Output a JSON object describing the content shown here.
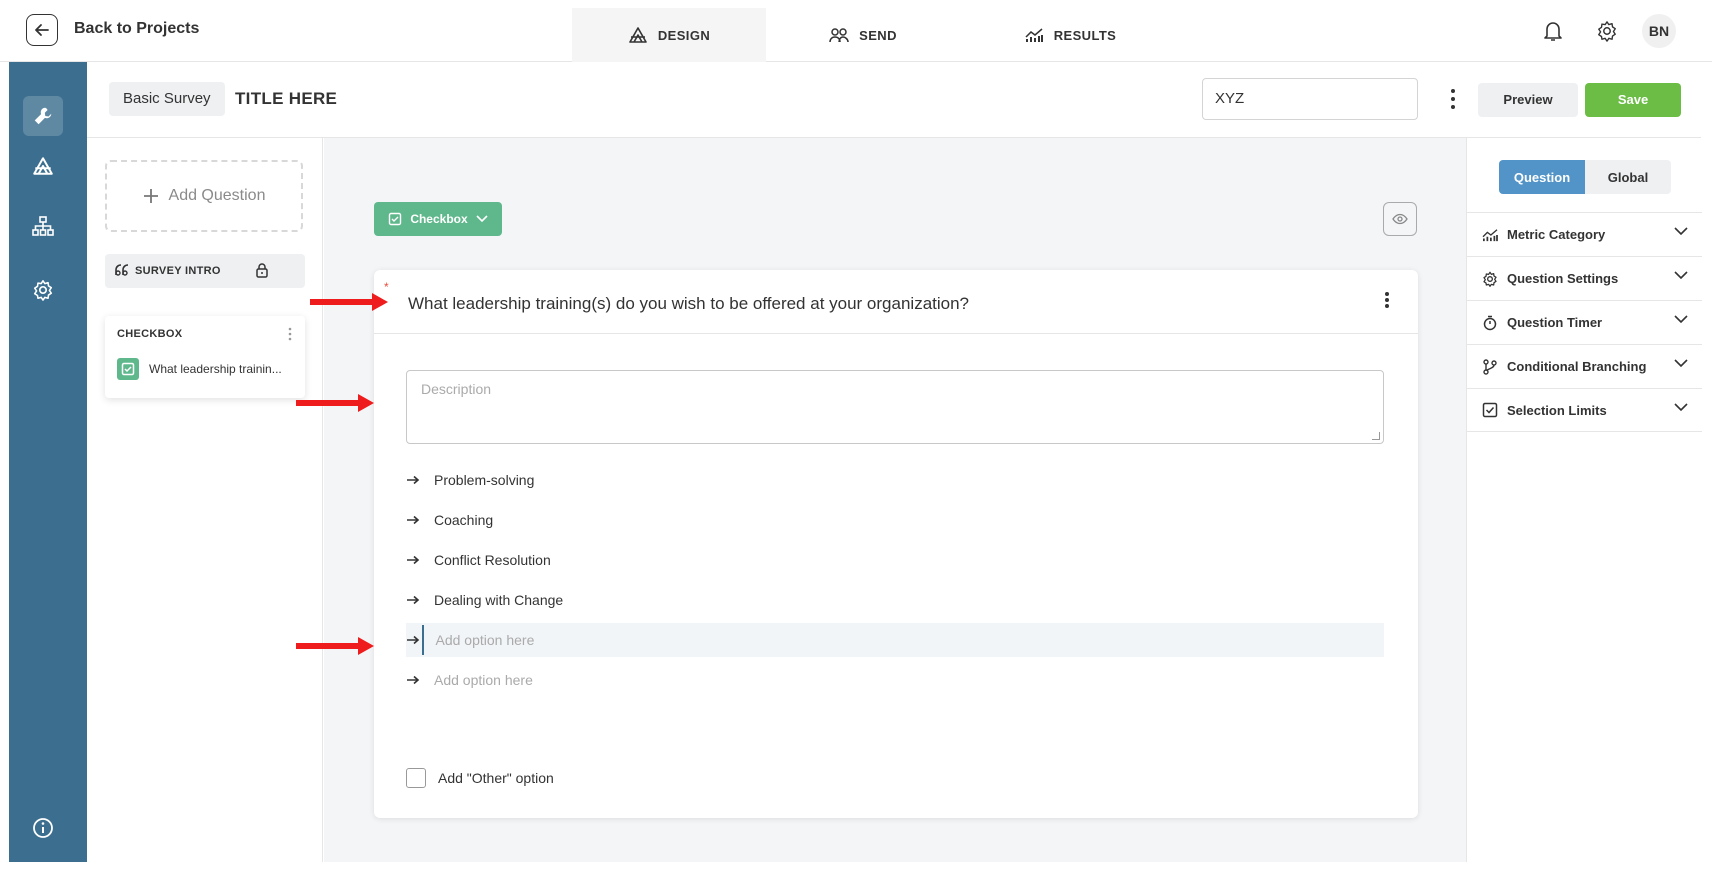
{
  "topbar": {
    "back_label": "Back to Projects",
    "tabs": [
      {
        "label": "DESIGN",
        "icon": "design-icon",
        "active": true
      },
      {
        "label": "SEND",
        "icon": "people-icon",
        "active": false
      },
      {
        "label": "RESULTS",
        "icon": "chart-icon",
        "active": false
      }
    ],
    "avatar_initials": "BN"
  },
  "header": {
    "survey_type": "Basic Survey",
    "survey_title": "TITLE HERE",
    "name_field_value": "XYZ",
    "preview_label": "Preview",
    "save_label": "Save"
  },
  "question_list": {
    "add_label": "Add Question",
    "intro_label": "SURVEY INTRO",
    "card_type": "CHECKBOX",
    "card_text": "What leadership trainin..."
  },
  "editor": {
    "type_label": "Checkbox",
    "question_text": "What leadership training(s) do you wish to be offered at your organization?",
    "description_placeholder": "Description",
    "options": [
      {
        "label": "Problem-solving",
        "placeholder": false
      },
      {
        "label": "Coaching",
        "placeholder": false
      },
      {
        "label": "Conflict Resolution",
        "placeholder": false
      },
      {
        "label": "Dealing with Change",
        "placeholder": false
      },
      {
        "label": "Add option here",
        "placeholder": true,
        "focused": true
      },
      {
        "label": "Add option here",
        "placeholder": true
      }
    ],
    "other_option_label": "Add \"Other\" option"
  },
  "settings_panel": {
    "tabs": [
      "Question",
      "Global"
    ],
    "active_tab": "Question",
    "sections": [
      {
        "label": "Metric Category",
        "icon": "chart-icon"
      },
      {
        "label": "Question Settings",
        "icon": "gear-icon"
      },
      {
        "label": "Question Timer",
        "icon": "timer-icon"
      },
      {
        "label": "Conditional Branching",
        "icon": "branch-icon"
      },
      {
        "label": "Selection Limits",
        "icon": "checkbox-icon"
      }
    ]
  },
  "colors": {
    "rail": "#3c6f8f",
    "save": "#6cbd45",
    "checkbox_badge": "#5fb88c",
    "segment_active": "#5294c8",
    "required_star": "#e84c3d",
    "annotation_arrow": "#ee1c1c"
  }
}
